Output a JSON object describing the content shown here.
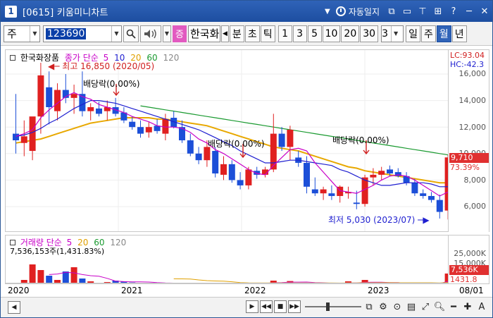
{
  "window": {
    "number": "1",
    "title": "[0615] 키움미니차트",
    "auto_save_label": "자동일지",
    "tb_icons": [
      "restore-icon",
      "minimize-icon",
      "pin-icon",
      "grid-icon",
      "help-icon",
      "close-icon"
    ]
  },
  "toolbar": {
    "market": "주",
    "code": "123690",
    "jeung_label": "증",
    "stock_name": "한국화장품",
    "period_buttons": [
      "분",
      "초",
      "틱"
    ],
    "number_buttons": [
      "1",
      "3",
      "5",
      "10",
      "20",
      "30"
    ],
    "count_value": "3",
    "range_buttons": [
      "일",
      "주",
      "월",
      "년"
    ],
    "active_range": "월"
  },
  "legend": {
    "stock": "한국화장품",
    "ma_label": "종가 단순",
    "periods": [
      "5",
      "10",
      "20",
      "60",
      "120"
    ],
    "colors": {
      "p5": "#c800c8",
      "p10": "#1f1fd0",
      "p20": "#e0a000",
      "p60": "#1a9a30",
      "p120": "#888888"
    }
  },
  "annotations": {
    "high": "최고 16,850 (2020/05)",
    "low": "최저 5,030 (2023/07)",
    "dividend": "배당락(0.00%)"
  },
  "price_axis": {
    "ticks": [
      "16,000",
      "14,000",
      "12,000",
      "10,000",
      "8,000",
      "6,000"
    ],
    "lc": "LC:93.04",
    "hc": "HC:-42.3",
    "current": "9,710",
    "change": "73.39%"
  },
  "volume": {
    "label": "거래량 단순",
    "periods": [
      "5",
      "20",
      "60",
      "120"
    ],
    "info": "7,536,153주(1,431.83%)",
    "ticks": [
      "25,000K",
      "15,000K"
    ],
    "current": "7,536K",
    "change": "1431.8"
  },
  "time_axis": {
    "years": [
      "2020",
      "2021",
      "2022",
      "2023"
    ],
    "last": "08/01"
  },
  "chart_data": {
    "type": "candlestick",
    "title": "한국화장품",
    "ylim": [
      5000,
      17000
    ],
    "candles": [
      {
        "o": 11500,
        "h": 14500,
        "l": 10000,
        "c": 11000
      },
      {
        "o": 10800,
        "h": 12500,
        "l": 9800,
        "c": 11300
      },
      {
        "o": 10200,
        "h": 12000,
        "l": 9500,
        "c": 12800
      },
      {
        "o": 12800,
        "h": 16850,
        "l": 11500,
        "c": 15900
      },
      {
        "o": 15000,
        "h": 16200,
        "l": 12200,
        "c": 13500
      },
      {
        "o": 13200,
        "h": 15300,
        "l": 12500,
        "c": 14800
      },
      {
        "o": 14800,
        "h": 16000,
        "l": 13800,
        "c": 14200
      },
      {
        "o": 14200,
        "h": 15200,
        "l": 13000,
        "c": 14500
      },
      {
        "o": 14500,
        "h": 16200,
        "l": 12800,
        "c": 13200
      },
      {
        "o": 13200,
        "h": 13800,
        "l": 12500,
        "c": 13500
      },
      {
        "o": 13400,
        "h": 13900,
        "l": 12800,
        "c": 13000
      },
      {
        "o": 13200,
        "h": 14000,
        "l": 12500,
        "c": 13500
      },
      {
        "o": 13500,
        "h": 14200,
        "l": 12800,
        "c": 13000
      },
      {
        "o": 13100,
        "h": 13500,
        "l": 12300,
        "c": 12500
      },
      {
        "o": 12400,
        "h": 12800,
        "l": 11800,
        "c": 12000
      },
      {
        "o": 12000,
        "h": 12500,
        "l": 11200,
        "c": 11500
      },
      {
        "o": 11600,
        "h": 12400,
        "l": 11200,
        "c": 12000
      },
      {
        "o": 12100,
        "h": 12600,
        "l": 11500,
        "c": 11700
      },
      {
        "o": 11500,
        "h": 13000,
        "l": 11000,
        "c": 12600
      },
      {
        "o": 12700,
        "h": 13200,
        "l": 11900,
        "c": 12000
      },
      {
        "o": 12000,
        "h": 12500,
        "l": 10800,
        "c": 11000
      },
      {
        "o": 11000,
        "h": 11500,
        "l": 9800,
        "c": 10000
      },
      {
        "o": 10000,
        "h": 10500,
        "l": 9200,
        "c": 9500
      },
      {
        "o": 9500,
        "h": 11000,
        "l": 9000,
        "c": 10500
      },
      {
        "o": 10200,
        "h": 10500,
        "l": 8200,
        "c": 8500
      },
      {
        "o": 8400,
        "h": 9800,
        "l": 8000,
        "c": 9200
      },
      {
        "o": 9200,
        "h": 9500,
        "l": 7800,
        "c": 8000
      },
      {
        "o": 8000,
        "h": 8600,
        "l": 7300,
        "c": 7600
      },
      {
        "o": 7600,
        "h": 9000,
        "l": 7300,
        "c": 8800
      },
      {
        "o": 8700,
        "h": 9000,
        "l": 8100,
        "c": 8400
      },
      {
        "o": 8400,
        "h": 9000,
        "l": 8200,
        "c": 8800
      },
      {
        "o": 8800,
        "h": 13000,
        "l": 8600,
        "c": 11500
      },
      {
        "o": 11500,
        "h": 12000,
        "l": 10200,
        "c": 10500
      },
      {
        "o": 10500,
        "h": 12100,
        "l": 9500,
        "c": 11800
      },
      {
        "o": 9700,
        "h": 10200,
        "l": 9000,
        "c": 9300
      },
      {
        "o": 9300,
        "h": 9800,
        "l": 7000,
        "c": 7500
      },
      {
        "o": 7300,
        "h": 8200,
        "l": 6800,
        "c": 7000
      },
      {
        "o": 7000,
        "h": 7500,
        "l": 6500,
        "c": 7300
      },
      {
        "o": 7000,
        "h": 7600,
        "l": 6500,
        "c": 6800
      },
      {
        "o": 6800,
        "h": 7600,
        "l": 6300,
        "c": 7500
      },
      {
        "o": 7000,
        "h": 7500,
        "l": 6600,
        "c": 7100
      },
      {
        "o": 6300,
        "h": 7200,
        "l": 5800,
        "c": 6200
      },
      {
        "o": 6200,
        "h": 8400,
        "l": 6000,
        "c": 8200
      },
      {
        "o": 8200,
        "h": 8900,
        "l": 7600,
        "c": 8400
      },
      {
        "o": 8400,
        "h": 9000,
        "l": 8000,
        "c": 8700
      },
      {
        "o": 8800,
        "h": 9100,
        "l": 8300,
        "c": 8500
      },
      {
        "o": 8600,
        "h": 8900,
        "l": 8200,
        "c": 8300
      },
      {
        "o": 8300,
        "h": 8600,
        "l": 7600,
        "c": 7800
      },
      {
        "o": 7800,
        "h": 8100,
        "l": 6800,
        "c": 7000
      },
      {
        "o": 7000,
        "h": 7300,
        "l": 6600,
        "c": 6800
      },
      {
        "o": 6800,
        "h": 7100,
        "l": 6300,
        "c": 6500
      },
      {
        "o": 6500,
        "h": 6900,
        "l": 5100,
        "c": 5600
      },
      {
        "o": 5700,
        "h": 9900,
        "l": 5030,
        "c": 9710
      }
    ],
    "ma5": [
      11300,
      11500,
      11800,
      12700,
      13300,
      13800,
      14300,
      14600,
      14300,
      14100,
      13700,
      13500,
      13300,
      13100,
      12800,
      12600,
      12400,
      12100,
      12000,
      12000,
      11900,
      11600,
      11100,
      10800,
      10300,
      10000,
      9600,
      9200,
      8800,
      8500,
      8400,
      9100,
      9700,
      10300,
      10400,
      10200,
      9300,
      8600,
      7900,
      7200,
      7100,
      7000,
      7300,
      7600,
      8000,
      8300,
      8400,
      8300,
      8000,
      7600,
      7200,
      6800,
      7100
    ],
    "ma10": [
      11300,
      11400,
      11600,
      11900,
      12300,
      12600,
      13000,
      13400,
      13700,
      14000,
      14000,
      13900,
      13800,
      13600,
      13400,
      13200,
      13000,
      12800,
      12600,
      12400,
      12200,
      12000,
      11800,
      11500,
      11200,
      10900,
      10600,
      10200,
      9900,
      9600,
      9300,
      9300,
      9400,
      9500,
      9500,
      9400,
      9300,
      9200,
      9100,
      8800,
      8600,
      8300,
      8000,
      7800,
      7600,
      7600,
      7700,
      7800,
      7800,
      7800,
      7700,
      7500,
      7500
    ],
    "ma20": [
      10800,
      10900,
      11000,
      11100,
      11300,
      11500,
      11700,
      11900,
      12100,
      12300,
      12400,
      12500,
      12600,
      12700,
      12700,
      12700,
      12700,
      12600,
      12600,
      12500,
      12400,
      12300,
      12200,
      12100,
      11900,
      11700,
      11500,
      11300,
      11100,
      10900,
      10700,
      10500,
      10400,
      10300,
      10200,
      10000,
      9800,
      9600,
      9400,
      9200,
      9000,
      8900,
      8700,
      8600,
      8500,
      8400,
      8300,
      8200,
      8100,
      8000,
      7900,
      7800,
      7800
    ],
    "ma60": [
      null,
      null,
      null,
      null,
      null,
      null,
      null,
      null,
      null,
      null,
      null,
      null,
      null,
      null,
      null,
      13600,
      13500,
      13400,
      13300,
      13200,
      13100,
      13000,
      12900,
      12800,
      12700,
      12600,
      12500,
      12400,
      12300,
      12200,
      12100,
      12000,
      11900,
      11800,
      11700,
      11600,
      11500,
      11400,
      11300,
      11200,
      11100,
      11000,
      10900,
      10800,
      10700,
      10600,
      10500,
      10400,
      10300,
      10200,
      10100,
      10000,
      9900
    ],
    "volume": [
      900,
      3000,
      14000,
      10000,
      6000,
      3000,
      9000,
      12000,
      4000,
      2000,
      1000,
      1500,
      2500,
      2000,
      1200,
      900,
      800,
      700,
      600,
      700,
      600,
      500,
      600,
      700,
      500,
      600,
      700,
      600,
      500,
      800,
      500,
      2500,
      1200,
      2200,
      800,
      700,
      600,
      700,
      500,
      600,
      2000,
      500,
      3000,
      900,
      700,
      600,
      500,
      400,
      500,
      400,
      400,
      800,
      7536
    ],
    "volume_ylim": [
      0,
      30000
    ]
  }
}
